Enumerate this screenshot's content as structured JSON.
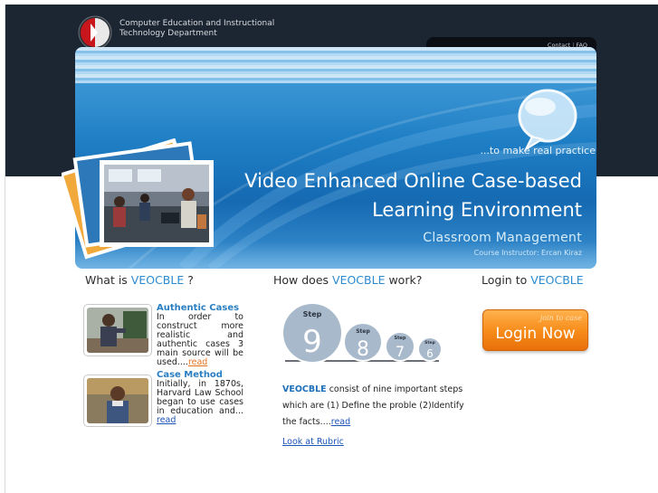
{
  "header": {
    "department_line1": "Computer Education and Instructional",
    "department_line2": "Technology Department",
    "nav": {
      "contact": "Contact",
      "separator": "|",
      "faq": "FAQ"
    }
  },
  "banner": {
    "tagline": "...to make real practice",
    "title_line1": "Video Enhanced Online Case-based",
    "title_line2": "Learning Environment",
    "subtitle": "Classroom  Management",
    "instructor": "Course Instructor: Ercan Kiraz"
  },
  "columns": {
    "what": {
      "prefix": "What is ",
      "brand": "VEOCBLE",
      "suffix": " ?"
    },
    "how": {
      "prefix": "How does ",
      "brand": "VEOCBLE",
      "suffix": " work?"
    },
    "login": {
      "prefix": "Login to ",
      "brand": "VEOCBLE",
      "suffix": ""
    }
  },
  "news": [
    {
      "title": "Authentic Cases",
      "body": "In order to construct more realistic and authentic cases 3 main source will be used....",
      "link": "read"
    },
    {
      "title": "Case Method",
      "body": "Initially, in 1870s, Harvard Law School began to use cases in education and...",
      "link": "read"
    }
  ],
  "steps": {
    "label": "Step",
    "items": [
      "9",
      "8",
      "7",
      "6"
    ]
  },
  "description": {
    "brand": "VEOCBLE",
    "text": " consist of nine important steps which are (1) Define the proble (2)Identify the facts....",
    "link": "read"
  },
  "rubric_link": "Look at Rubric",
  "login_button": {
    "hint": "join to case",
    "label": "Login Now"
  },
  "colors": {
    "top_band": "#1c2633",
    "brand_blue": "#2a8bd0",
    "login_orange": "#f68a17",
    "link_blue": "#1a55b8",
    "read_orange": "#e6731f"
  }
}
